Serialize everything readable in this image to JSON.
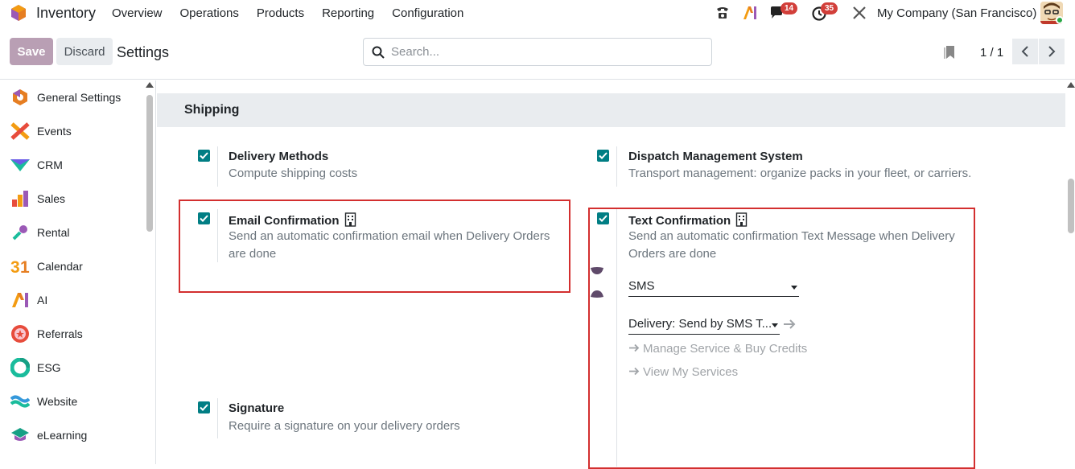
{
  "navbar": {
    "app_name": "Inventory",
    "menu": [
      "Overview",
      "Operations",
      "Products",
      "Reporting",
      "Configuration"
    ],
    "chat_badge": "14",
    "activity_badge": "35",
    "company": "My Company (San Francisco)"
  },
  "control": {
    "save_label": "Save",
    "discard_label": "Discard",
    "title": "Settings",
    "search_placeholder": "Search...",
    "pager": "1 / 1"
  },
  "sidebar": {
    "items": [
      {
        "label": "General Settings",
        "icon": "general-settings-icon"
      },
      {
        "label": "Events",
        "icon": "events-icon"
      },
      {
        "label": "CRM",
        "icon": "crm-icon"
      },
      {
        "label": "Sales",
        "icon": "sales-icon"
      },
      {
        "label": "Rental",
        "icon": "rental-icon"
      },
      {
        "label": "Calendar",
        "icon": "calendar-icon"
      },
      {
        "label": "AI",
        "icon": "ai-icon"
      },
      {
        "label": "Referrals",
        "icon": "referrals-icon"
      },
      {
        "label": "ESG",
        "icon": "esg-icon"
      },
      {
        "label": "Website",
        "icon": "website-icon"
      },
      {
        "label": "eLearning",
        "icon": "elearning-icon"
      }
    ]
  },
  "section": {
    "title": "Shipping",
    "settings": [
      {
        "title": "Delivery Methods",
        "desc": "Compute shipping costs",
        "checked": true
      },
      {
        "title": "Dispatch Management System",
        "desc": "Transport management: organize packs in your fleet, or carriers.",
        "checked": true
      },
      {
        "title": "Email Confirmation",
        "desc": "Send an automatic confirmation email when Delivery Orders are done",
        "checked": true
      },
      {
        "title": "Text Confirmation",
        "desc": "Send an automatic confirmation Text Message when Delivery Orders are done",
        "checked": true
      },
      {
        "title": "Signature",
        "desc": "Require a signature on your delivery orders",
        "checked": true
      }
    ],
    "sms_select": "SMS",
    "template_select": "Delivery: Send by SMS T...",
    "manage_link": "Manage Service & Buy Credits",
    "services_link": "View My Services"
  },
  "colors": {
    "accent": "#017e84",
    "save_button": "#b99fb4",
    "highlight": "#d32f2f",
    "badge": "#d23f3a"
  }
}
